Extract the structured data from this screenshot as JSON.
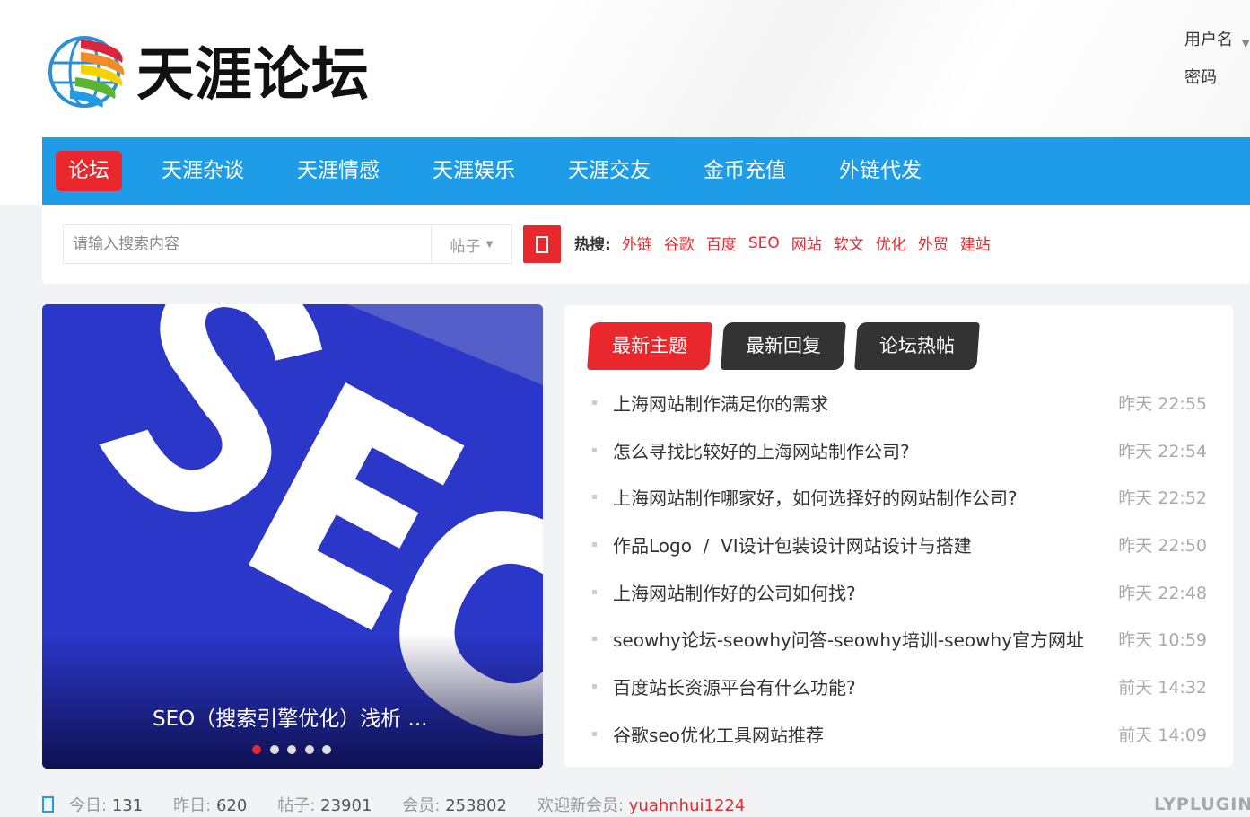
{
  "header": {
    "logo_text": "天涯论坛",
    "login": {
      "username_label": "用户名",
      "password_label": "密码"
    }
  },
  "nav": {
    "items": [
      "论坛",
      "天涯杂谈",
      "天涯情感",
      "天涯娱乐",
      "天涯交友",
      "金币充值",
      "外链代发"
    ],
    "active_index": 0
  },
  "search": {
    "placeholder": "请输入搜索内容",
    "type_label": "帖子",
    "hot_label": "热搜:",
    "hot_links": [
      "外链",
      "谷歌",
      "百度",
      "SEO",
      "网站",
      "软文",
      "优化",
      "外贸",
      "建站"
    ]
  },
  "slider": {
    "caption": "SEO（搜索引擎优化）浅析 ...",
    "dot_count": 5,
    "active_dot": 0,
    "colors": {
      "background": "#2b37c9"
    }
  },
  "topics": {
    "tabs": [
      "最新主题",
      "最新回复",
      "论坛热帖"
    ],
    "active_tab": 0,
    "items": [
      {
        "title": "上海网站制作满足你的需求",
        "time": "昨天 22:55"
      },
      {
        "title": "怎么寻找比较好的上海网站制作公司?",
        "time": "昨天 22:54"
      },
      {
        "title": "上海网站制作哪家好，如何选择好的网站制作公司?",
        "time": "昨天 22:52"
      },
      {
        "title": "作品Logo  /  VI设计包装设计网站设计与搭建",
        "time": "昨天 22:50"
      },
      {
        "title": "上海网站制作好的公司如何找?",
        "time": "昨天 22:48"
      },
      {
        "title": "seowhy论坛-seowhy问答-seowhy培训-seowhy官方网址",
        "time": "昨天 10:59"
      },
      {
        "title": "百度站长资源平台有什么功能?",
        "time": "前天 14:32"
      },
      {
        "title": "谷歌seo优化工具网站推荐",
        "time": "前天 14:09"
      }
    ]
  },
  "stats": {
    "today_label": "今日:",
    "today": "131",
    "yesterday_label": "昨日:",
    "yesterday": "620",
    "posts_label": "帖子:",
    "posts": "23901",
    "members_label": "会员:",
    "members": "253802",
    "newest_label": "欢迎新会员:",
    "newest_user": "yuahnhui1224"
  },
  "watermark": "LYPLUGIN",
  "colors": {
    "accent": "#e8282d",
    "nav": "#1e9ce8",
    "tab_dark": "#333333"
  }
}
